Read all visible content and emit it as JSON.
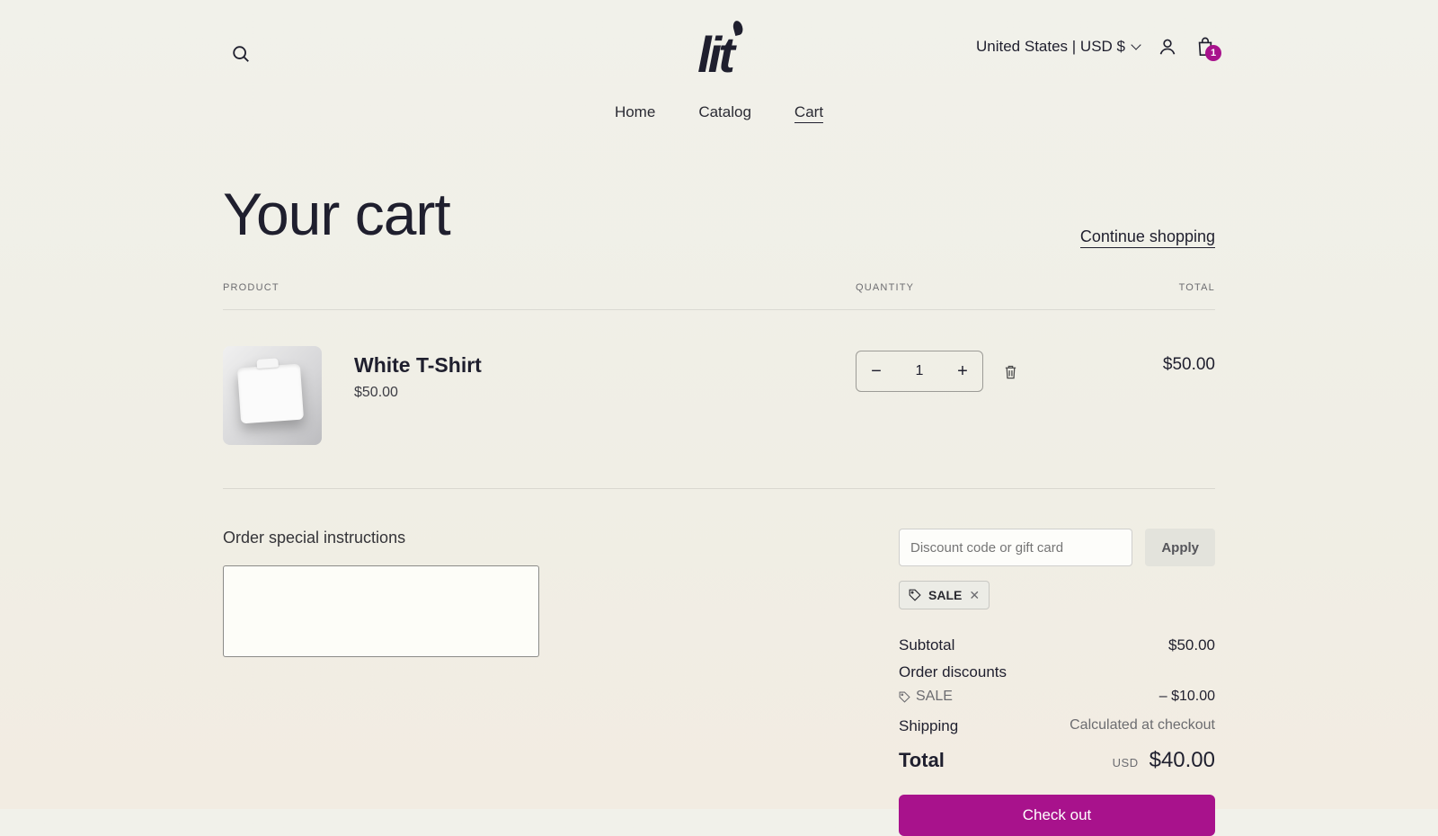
{
  "header": {
    "logo": "lit",
    "locale": "United States | USD $",
    "cart_badge": "1",
    "nav": {
      "home": "Home",
      "catalog": "Catalog",
      "cart": "Cart"
    }
  },
  "title": "Your cart",
  "continue": "Continue shopping",
  "columns": {
    "product": "PRODUCT",
    "quantity": "QUANTITY",
    "total": "TOTAL"
  },
  "item": {
    "name": "White T-Shirt",
    "price": "$50.00",
    "qty": "1",
    "line_total": "$50.00"
  },
  "instructions": {
    "label": "Order special instructions",
    "value": ""
  },
  "discount": {
    "placeholder": "Discount code or gift card",
    "apply": "Apply",
    "chip": "SALE"
  },
  "summary": {
    "subtotal_label": "Subtotal",
    "subtotal_value": "$50.00",
    "order_discounts_label": "Order discounts",
    "discount_line_label": "SALE",
    "discount_line_value": "– $10.00",
    "shipping_label": "Shipping",
    "shipping_value": "Calculated at checkout",
    "total_label": "Total",
    "currency": "USD",
    "total_value": "$40.00"
  },
  "checkout": "Check out"
}
